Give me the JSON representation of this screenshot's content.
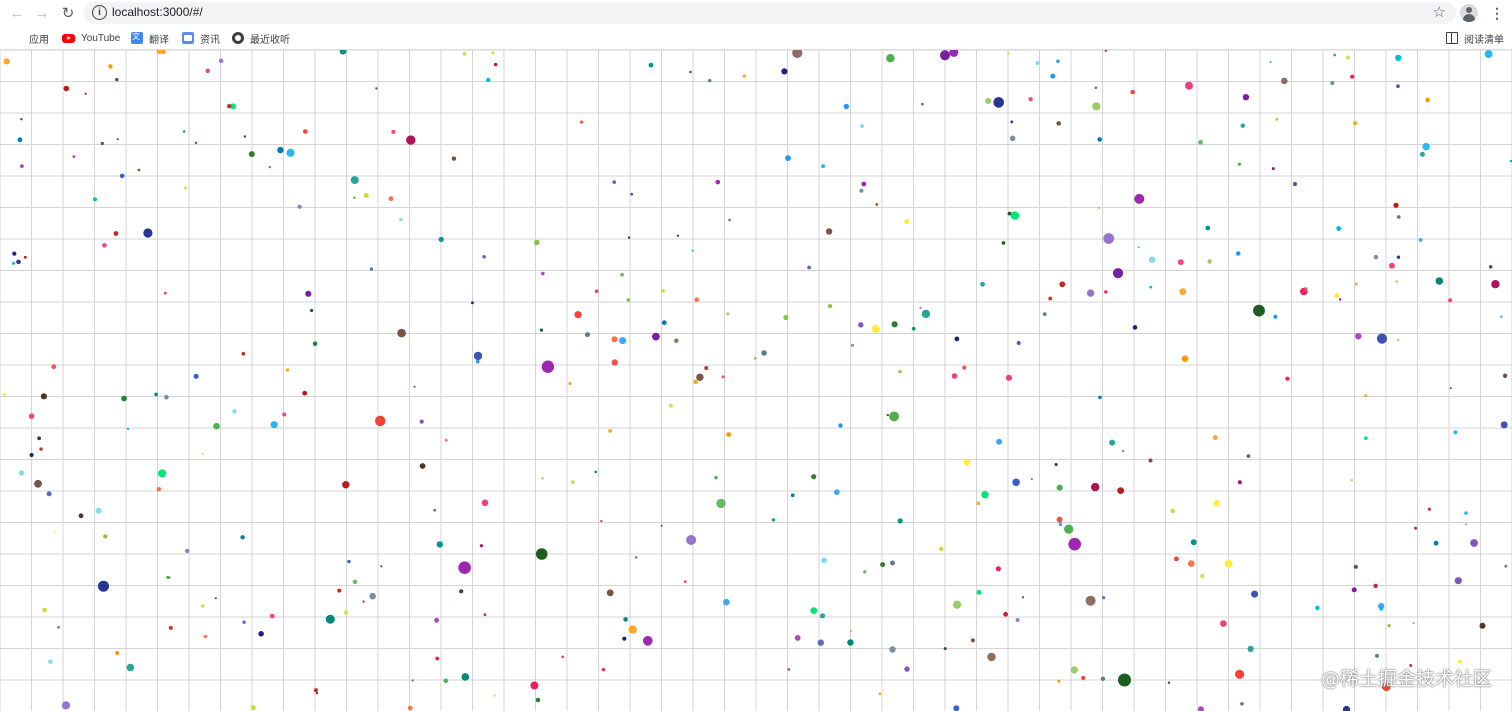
{
  "browser": {
    "url": "localhost:3000/#/",
    "reading_list_label": "阅读清单"
  },
  "bookmarks": [
    {
      "label": "应用",
      "icon": "apps-grid-icon"
    },
    {
      "label": "YouTube",
      "icon": "youtube-icon"
    },
    {
      "label": "翻译",
      "icon": "translate-icon"
    },
    {
      "label": "资讯",
      "icon": "news-icon"
    },
    {
      "label": "最近收听",
      "icon": "recent-listen-icon"
    }
  ],
  "watermark": "@稀土掘金技术社区",
  "scene": {
    "grid_color": "#d4d4d4",
    "dots": [
      [
        "#3a5fcd",
        4
      ],
      [
        "#1a237e",
        3
      ],
      [
        "#7b1fa2",
        5
      ],
      [
        "#c0392b",
        2
      ],
      [
        "#00bcd4",
        3
      ],
      [
        "#e91e63",
        4
      ],
      [
        "#8bc34a",
        3
      ],
      [
        "#4caf50",
        5
      ],
      [
        "#ff9800",
        3
      ],
      [
        "#9c27b0",
        6
      ],
      [
        "#2196f3",
        3
      ],
      [
        "#795548",
        4
      ],
      [
        "#607d8b",
        3
      ],
      [
        "#f44336",
        5
      ],
      [
        "#009688",
        4
      ],
      [
        "#cddc39",
        3
      ],
      [
        "#3f51b5",
        5
      ],
      [
        "#00e676",
        4
      ],
      [
        "#ff4081",
        3
      ],
      [
        "#1b5e20",
        6
      ],
      [
        "#b71c1c",
        4
      ],
      [
        "#80deea",
        3
      ],
      [
        "#ffeb3b",
        4
      ],
      [
        "#6d4c41",
        3
      ],
      [
        "#9575cd",
        5
      ],
      [
        "#26a69a",
        4
      ],
      [
        "#ef5350",
        3
      ],
      [
        "#66bb6a",
        5
      ],
      [
        "#42a5f5",
        4
      ],
      [
        "#ab47bc",
        3
      ],
      [
        "#d4e157",
        2
      ],
      [
        "#ffa726",
        4
      ],
      [
        "#8d6e63",
        5
      ],
      [
        "#78909c",
        3
      ],
      [
        "#ec407a",
        4
      ],
      [
        "#5c6bc0",
        3
      ],
      [
        "#29b6f6",
        5
      ],
      [
        "#9ccc65",
        4
      ],
      [
        "#ff7043",
        3
      ],
      [
        "#7e57c2",
        4
      ],
      [
        "#00897b",
        5
      ],
      [
        "#c62828",
        3
      ],
      [
        "#283593",
        6
      ],
      [
        "#2e7d32",
        4
      ],
      [
        "#f9a825",
        3
      ],
      [
        "#4e342e",
        4
      ],
      [
        "#0277bd",
        3
      ],
      [
        "#ad1457",
        5
      ]
    ]
  }
}
